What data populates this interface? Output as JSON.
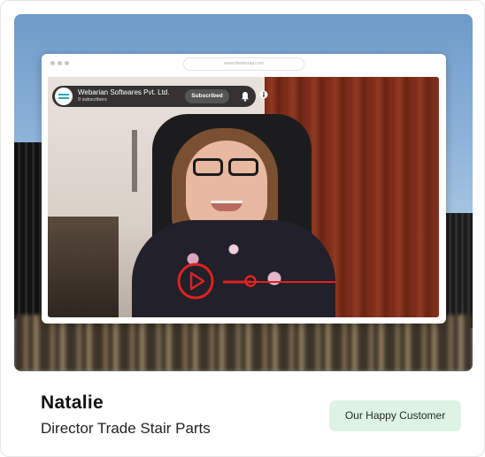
{
  "browser": {
    "url": "www.themezaa.com"
  },
  "video": {
    "channel_name": "Webarian Softwares Pvt. Ltd.",
    "subscribers": "9 subscribers",
    "subscribed_label": "Subscribed",
    "icons": [
      "bell-icon",
      "info-icon",
      "play-icon"
    ],
    "progress": 0.25,
    "accent_color": "#e0221f"
  },
  "testimonial": {
    "name": "Natalie",
    "role": "Director Trade Stair Parts",
    "badge_label": "Our Happy Customer",
    "badge_color": "#dff2e6"
  }
}
